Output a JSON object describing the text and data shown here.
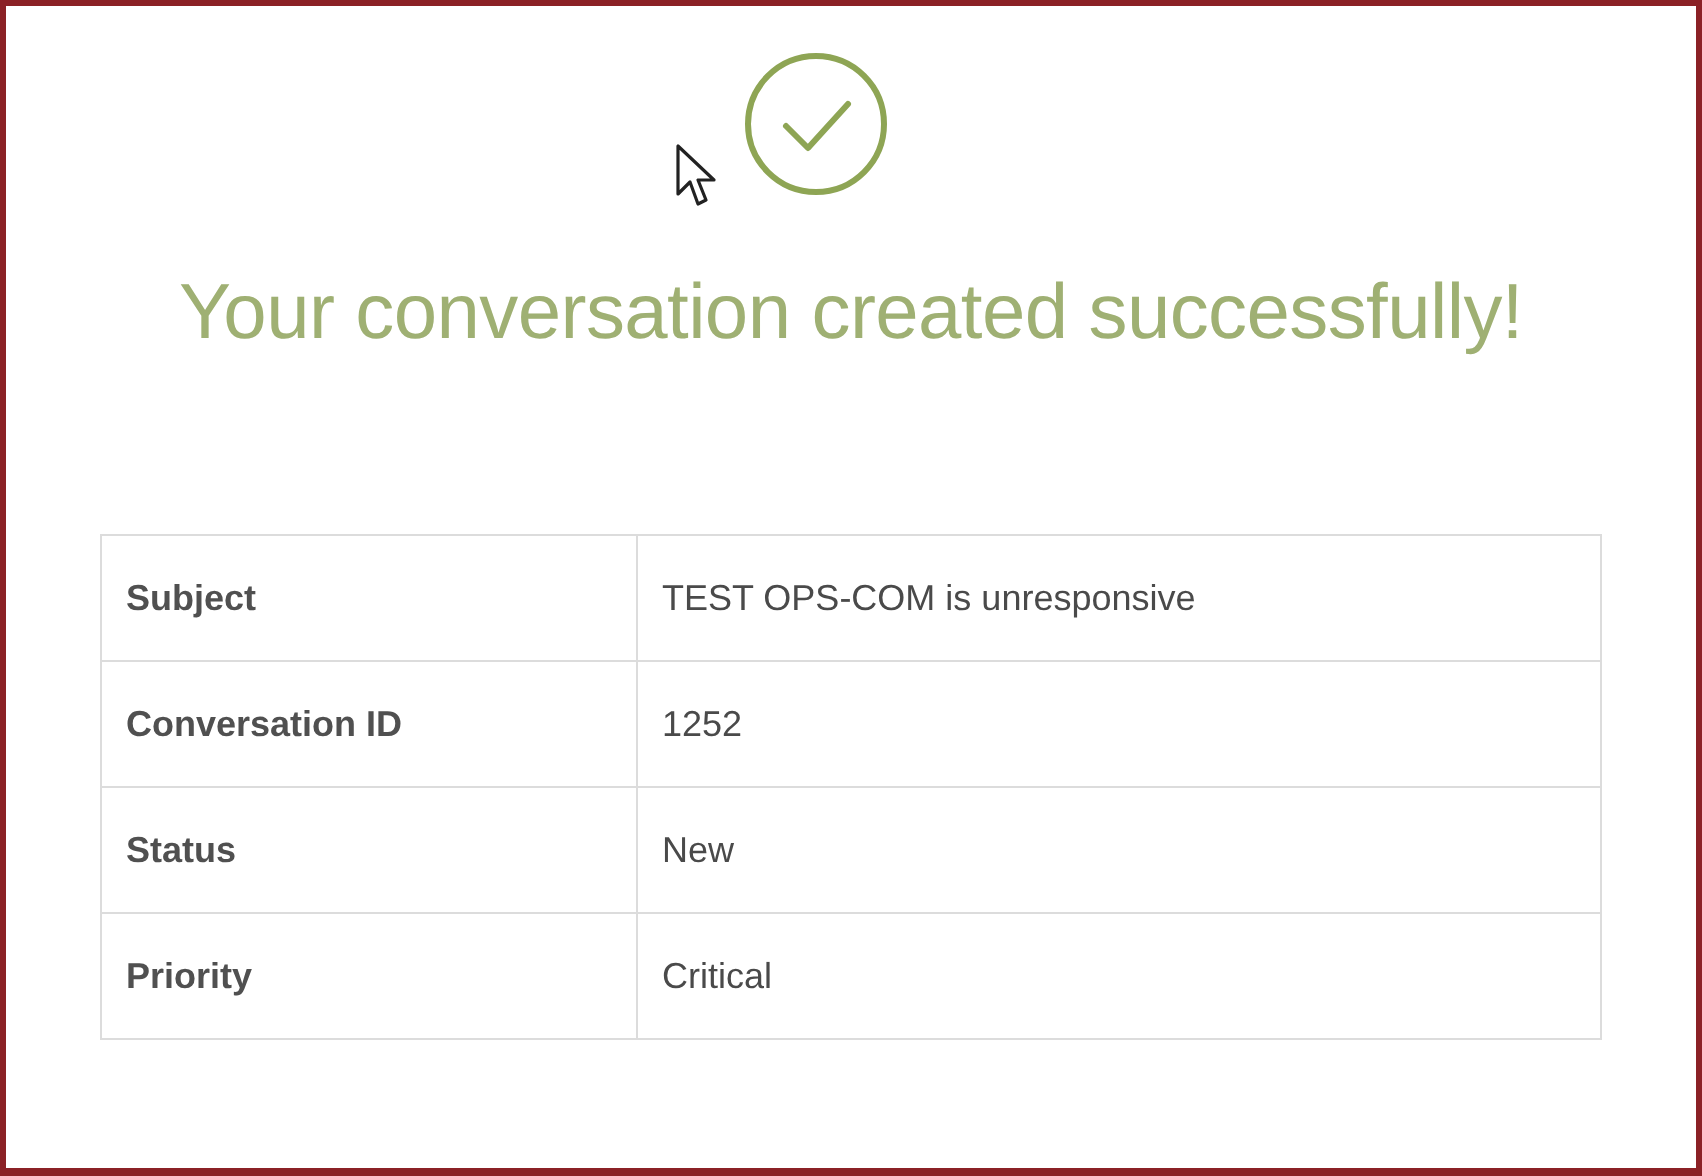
{
  "heading": "Your conversation created successfully!",
  "details": [
    {
      "label": "Subject",
      "value": "TEST OPS-COM is unresponsive"
    },
    {
      "label": "Conversation ID",
      "value": "1252"
    },
    {
      "label": "Status",
      "value": "New"
    },
    {
      "label": "Priority",
      "value": "Critical"
    }
  ]
}
